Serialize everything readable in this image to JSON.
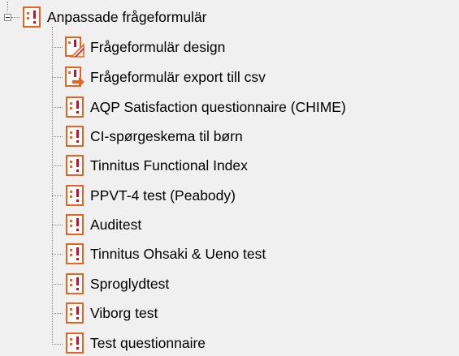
{
  "tree": {
    "root": {
      "label": "Anpassade frågeformulär",
      "expanded": true,
      "icon": "questionnaire-icon"
    },
    "children": [
      {
        "label": "Frågeformulär design",
        "icon": "questionnaire-design-icon"
      },
      {
        "label": "Frågeformulär export till csv",
        "icon": "questionnaire-export-icon"
      },
      {
        "label": "AQP Satisfaction questionnaire (CHIME)",
        "icon": "questionnaire-icon"
      },
      {
        "label": "CI-spørgeskema til børn",
        "icon": "questionnaire-icon"
      },
      {
        "label": "Tinnitus Functional Index",
        "icon": "questionnaire-icon"
      },
      {
        "label": "PPVT-4 test (Peabody)",
        "icon": "questionnaire-icon"
      },
      {
        "label": "Auditest",
        "icon": "questionnaire-icon"
      },
      {
        "label": "Tinnitus Ohsaki & Ueno test",
        "icon": "questionnaire-icon"
      },
      {
        "label": "Sproglydtest",
        "icon": "questionnaire-icon"
      },
      {
        "label": "Viborg test",
        "icon": "questionnaire-icon"
      },
      {
        "label": "Test questionnaire",
        "icon": "questionnaire-icon"
      }
    ]
  },
  "colors": {
    "icon_orange": "#e8641e",
    "icon_red": "#c8102e",
    "connector": "#8a8a8a",
    "background": "#f0f0f0"
  }
}
